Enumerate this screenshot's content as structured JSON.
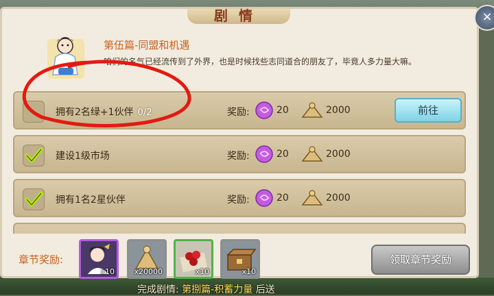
{
  "window": {
    "title": "剧情",
    "close": "×"
  },
  "chapter": {
    "title": "第伍篇-同盟和机遇",
    "description": "咱们的名气已经流传到了外界，也是时候找些志同道合的朋友了，毕竟人多力量大嘛。"
  },
  "tasks": [
    {
      "name": "拥有2名绿+1伙伴",
      "progress": "0/2",
      "completed": false,
      "reward_label": "奖励:",
      "gem_reward": "20",
      "food_reward": "2000",
      "action": "前往"
    },
    {
      "name": "建设1级市场",
      "progress": "",
      "completed": true,
      "reward_label": "奖励:",
      "gem_reward": "20",
      "food_reward": "2000",
      "action": ""
    },
    {
      "name": "拥有1名2星伙伴",
      "progress": "",
      "completed": true,
      "reward_label": "奖励:",
      "gem_reward": "20",
      "food_reward": "2000",
      "action": ""
    }
  ],
  "chapter_rewards": {
    "label": "章节奖励:",
    "items": [
      {
        "icon": "hero-portrait-icon",
        "qty": "x10",
        "border": "#b25be0"
      },
      {
        "icon": "food-pile-icon",
        "qty": "x20000",
        "border": "#8e8e8e"
      },
      {
        "icon": "red-fruit-icon",
        "qty": "x10",
        "border": "#4fb34a"
      },
      {
        "icon": "treasure-chest-icon",
        "qty": "x10",
        "border": "#8e8e8e"
      }
    ],
    "claim_button": "领取章节奖励"
  },
  "bottom_bar": {
    "prefix": "完成剧情:",
    "highlight": "第捌篇-积蓄力量",
    "suffix": "后送"
  },
  "colors": {
    "accent": "#c9601f",
    "check": "#b9e614",
    "circle": "#e31a12"
  }
}
